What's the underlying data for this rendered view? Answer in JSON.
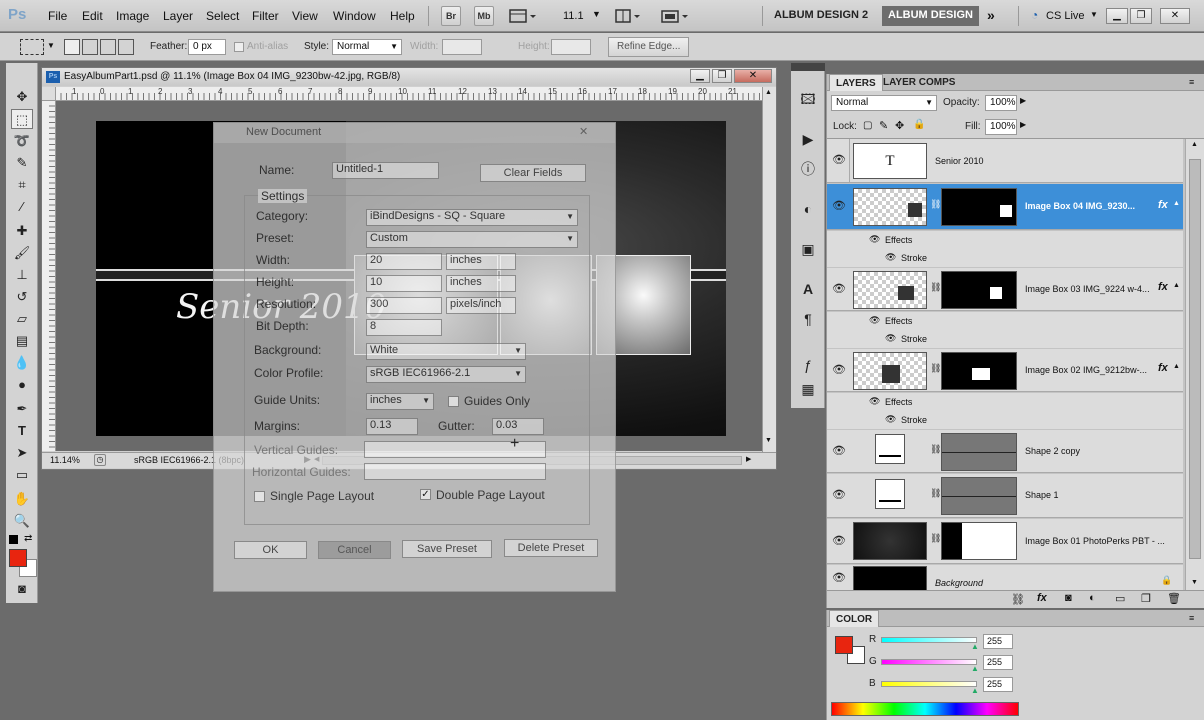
{
  "app": {
    "logo": "Ps"
  },
  "menu": [
    "File",
    "Edit",
    "Image",
    "Layer",
    "Select",
    "Filter",
    "View",
    "Window",
    "Help"
  ],
  "menubar": {
    "br": "Br",
    "mb": "Mb",
    "zoom_value": "11.1",
    "workspace_inactive": "ALBUM DESIGN 2",
    "workspace_active": "ALBUM DESIGN",
    "cs_live": "CS Live"
  },
  "options": {
    "feather_label": "Feather:",
    "feather_value": "0 px",
    "antialias_label": "Anti-alias",
    "style_label": "Style:",
    "style_value": "Normal",
    "width_label": "Width:",
    "height_label": "Height:",
    "refine_edge": "Refine Edge..."
  },
  "document": {
    "title": "EasyAlbumPart1.psd @ 11.1% (Image Box 04 IMG_9230bw-42.jpg, RGB/8)",
    "ruler_ticks": [
      "1",
      "0",
      "1",
      "2",
      "3",
      "4",
      "5",
      "6",
      "7",
      "8",
      "9",
      "10",
      "11",
      "12",
      "13",
      "14",
      "15",
      "16",
      "17",
      "18",
      "19",
      "20",
      "21"
    ],
    "zoom": "11.14%",
    "status": "sRGB IEC61966-2.1 (8bpc)",
    "canvas_text": "Senior 2010"
  },
  "ghost_dialog": {
    "title": "New Document",
    "name_label": "Name:",
    "name_value": "Untitled-1",
    "clear_fields": "Clear Fields",
    "settings_label": "Settings",
    "category_label": "Category:",
    "category_value": "iBindDesigns - SQ - Square",
    "preset_label": "Preset:",
    "preset_value": "Custom",
    "width_label": "Width:",
    "width_value": "20",
    "width_unit": "inches",
    "height_label": "Height:",
    "height_value": "10",
    "height_unit": "inches",
    "resolution_label": "Resolution:",
    "resolution_value": "300",
    "resolution_unit": "pixels/inch",
    "bitdepth_label": "Bit Depth:",
    "bitdepth_value": "8",
    "background_label": "Background:",
    "background_value": "White",
    "profile_label": "Color Profile:",
    "profile_value": "sRGB IEC61966-2.1",
    "guide_units_label": "Guide Units:",
    "guide_units_value": "inches",
    "guides_only": "Guides Only",
    "margins_label": "Margins:",
    "margins_value": "0.13",
    "gutter_label": "Gutter:",
    "gutter_value": "0.03",
    "vertical_guides_label": "Vertical Guides:",
    "horizontal_guides_label": "Horizontal Guides:",
    "single_page": "Single Page Layout",
    "double_page": "Double Page Layout",
    "ok": "OK",
    "cancel": "Cancel",
    "save_preset": "Save Preset",
    "delete_preset": "Delete Preset"
  },
  "layers_panel": {
    "tabs": [
      "LAYERS",
      "LAYER COMPS"
    ],
    "blend_mode": "Normal",
    "opacity_label": "Opacity:",
    "opacity_value": "100%",
    "lock_label": "Lock:",
    "fill_label": "Fill:",
    "fill_value": "100%",
    "effects_label": "Effects",
    "stroke_label": "Stroke",
    "layers": [
      {
        "name": "Senior 2010"
      },
      {
        "name": "Image Box 04 IMG_9230..."
      },
      {
        "name": "Image Box 03 IMG_9224 w-4..."
      },
      {
        "name": "Image Box 02 IMG_9212bw-..."
      },
      {
        "name": "Shape 2 copy"
      },
      {
        "name": "Shape 1"
      },
      {
        "name": "Image Box 01 PhotoPerks PBT - ..."
      },
      {
        "name": "Background"
      }
    ]
  },
  "color_panel": {
    "title": "COLOR",
    "r_label": "R",
    "g_label": "G",
    "b_label": "B",
    "r_value": "255",
    "g_value": "255",
    "b_value": "255",
    "foreground": "#ff2200",
    "background": "#ffffff"
  },
  "colors": {
    "accent": "#3d8fd8",
    "foreground_swatch": "#e8250f"
  }
}
